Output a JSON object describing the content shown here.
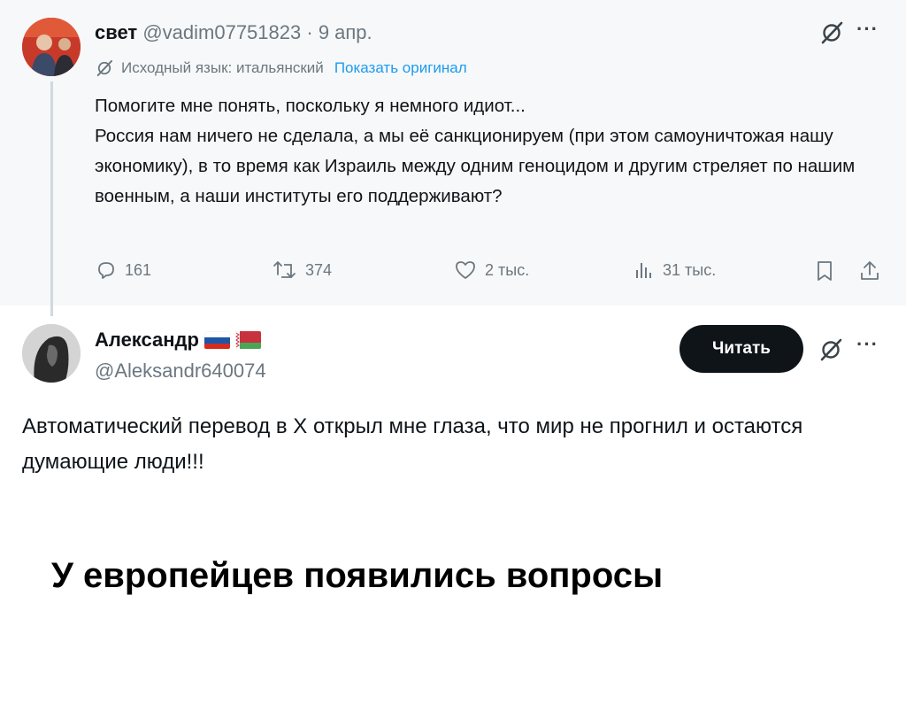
{
  "tweet1": {
    "name": "свет",
    "handle": "@vadim07751823",
    "separator": "·",
    "date": "9 апр.",
    "translation_note": "Исходный язык: итальянский",
    "show_original": "Показать оригинал",
    "body_lines": [
      "Помогите мне понять, поскольку я немного идиот...",
      "Россия нам ничего не сделала, а мы её санкционируем (при этом самоуничтожая нашу экономику), в то время как Израиль между одним геноцидом и другим стреляет по нашим военным, а наши институты его поддерживают?"
    ],
    "stats": {
      "replies": "161",
      "retweets": "374",
      "likes": "2 тыс.",
      "views": "31 тыс."
    },
    "more": "···"
  },
  "tweet2": {
    "name": "Александр",
    "handle": "@Aleksandr640074",
    "follow_label": "Читать",
    "more": "···",
    "body": "Автоматический перевод в X открыл мне глаза, что мир не прогнил и остаются думающие люди!!!"
  },
  "caption": "У европейцев появились вопросы",
  "colors": {
    "accent": "#1d9bf0",
    "muted": "#6b7780",
    "top_bg": "#f7f8f9",
    "button_bg": "#0f1419"
  },
  "icons": [
    "grok-icon",
    "more-icon",
    "reply-icon",
    "retweet-icon",
    "like-icon",
    "views-icon",
    "bookmark-icon",
    "share-icon"
  ]
}
